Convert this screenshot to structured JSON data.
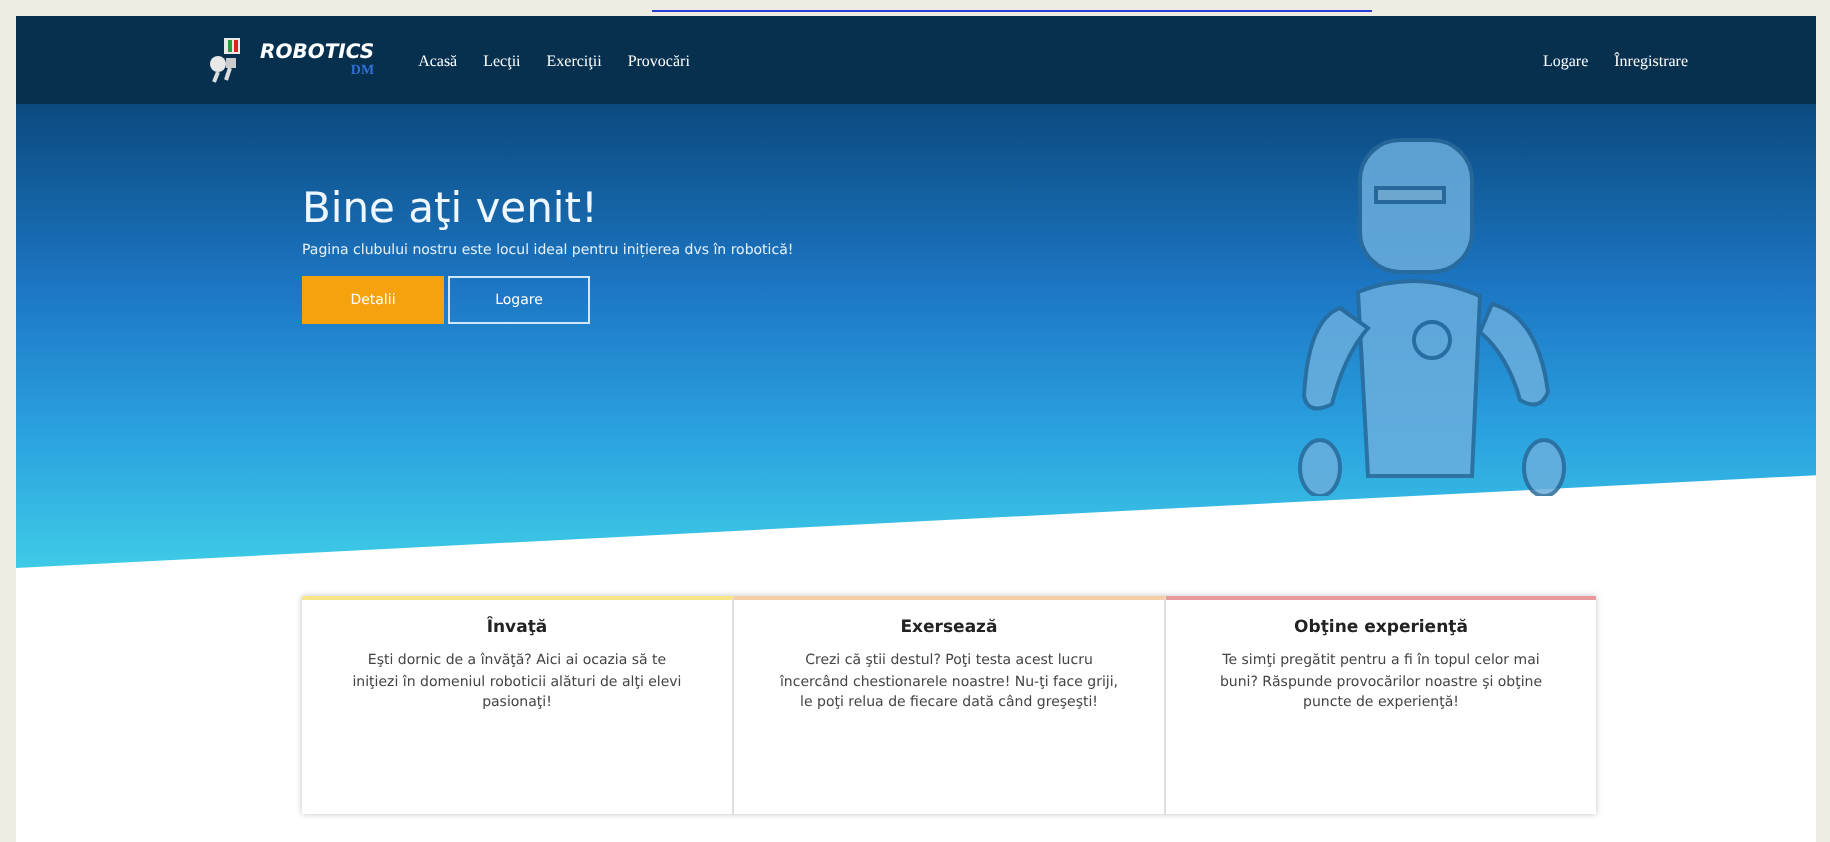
{
  "navbar": {
    "logo": {
      "title": "ROBOTICS",
      "subtitle": "DM"
    },
    "links": [
      {
        "label": "Acasă"
      },
      {
        "label": "Lecţii"
      },
      {
        "label": "Exerciţii"
      },
      {
        "label": "Provocări"
      }
    ],
    "account_links": [
      {
        "label": "Logare"
      },
      {
        "label": "Înregistrare"
      }
    ]
  },
  "hero": {
    "title": "Bine aţi venit!",
    "subtitle": "Pagina clubului nostru este locul ideal pentru inițierea dvs în robotică!",
    "buttons": [
      {
        "label": "Detalii",
        "kind": "primary"
      },
      {
        "label": "Logare",
        "kind": "outline"
      }
    ]
  },
  "features": [
    {
      "title": "Învaţă",
      "text": "Eşti dornic de a învăţă? Aici ai ocazia să te iniţiezi în domeniul roboticii alături de alţi elevi pasionaţi!",
      "color": "#f7e58a"
    },
    {
      "title": "Exersează",
      "text": "Crezi că ştii destul? Poţi testa acest lucru încercând chestionarele noastre! Nu-ţi face griji, le poţi relua de fiecare dată când greşeşti!",
      "color": "#f4cfa6"
    },
    {
      "title": "Obţine experienţă",
      "text": "Te simţi pregătit pentru a fi în topul celor mai buni? Răspunde provocărilor noastre şi obţine puncte de experienţă!",
      "color": "#e99a9c"
    }
  ]
}
